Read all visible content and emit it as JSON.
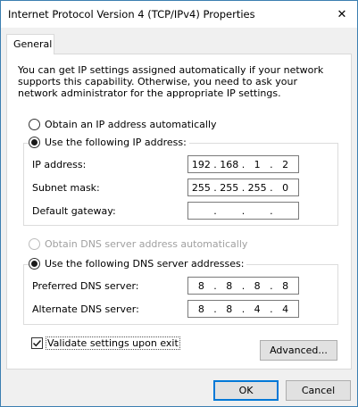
{
  "window": {
    "title": "Internet Protocol Version 4 (TCP/IPv4) Properties",
    "close_glyph": "✕"
  },
  "tabs": [
    {
      "label": "General",
      "selected": true
    }
  ],
  "description": "You can get IP settings assigned automatically if your network supports this capability. Otherwise, you need to ask your network administrator for the appropriate IP settings.",
  "ip_section": {
    "auto_option": {
      "label": "Obtain an IP address automatically",
      "selected": false
    },
    "manual_option": {
      "label": "Use the following IP address:",
      "selected": true
    },
    "fields": [
      {
        "label": "IP address:",
        "octets": [
          "192",
          "168",
          "1",
          "2"
        ]
      },
      {
        "label": "Subnet mask:",
        "octets": [
          "255",
          "255",
          "255",
          "0"
        ]
      },
      {
        "label": "Default gateway:",
        "octets": [
          "",
          "",
          "",
          ""
        ]
      }
    ]
  },
  "dns_section": {
    "auto_option": {
      "label": "Obtain DNS server address automatically",
      "selected": false,
      "disabled": true
    },
    "manual_option": {
      "label": "Use the following DNS server addresses:",
      "selected": true
    },
    "fields": [
      {
        "label": "Preferred DNS server:",
        "octets": [
          "8",
          "8",
          "8",
          "8"
        ]
      },
      {
        "label": "Alternate DNS server:",
        "octets": [
          "8",
          "8",
          "4",
          "4"
        ]
      }
    ]
  },
  "validate_checkbox": {
    "label": "Validate settings upon exit",
    "checked": true
  },
  "buttons": {
    "advanced": "Advanced...",
    "ok": "OK",
    "cancel": "Cancel"
  },
  "colors": {
    "accent": "#0078d7",
    "window_border": "#3c7fb1",
    "dialog_bg": "#f0f0f0"
  },
  "icons": {
    "close": "close-icon",
    "check": "checkmark-icon"
  }
}
